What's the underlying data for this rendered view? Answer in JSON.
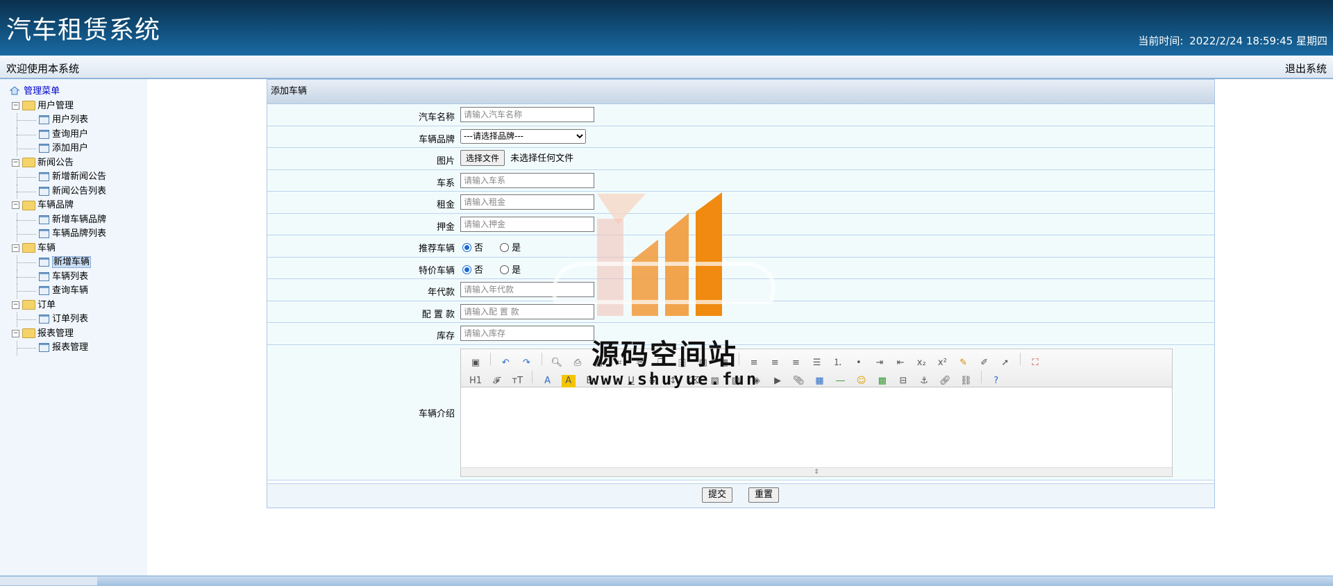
{
  "header": {
    "title": "汽车租赁系统",
    "clock_label": "当前时间:",
    "clock_value": "2022/2/24 18:59:45 星期四"
  },
  "welcome_bar": {
    "welcome": "欢迎使用本系统",
    "logout": "退出系统"
  },
  "sidebar": {
    "root": "管理菜单",
    "groups": [
      {
        "label": "用户管理",
        "items": [
          "用户列表",
          "查询用户",
          "添加用户"
        ]
      },
      {
        "label": "新闻公告",
        "items": [
          "新增新闻公告",
          "新闻公告列表"
        ]
      },
      {
        "label": "车辆品牌",
        "items": [
          "新增车辆品牌",
          "车辆品牌列表"
        ]
      },
      {
        "label": "车辆",
        "items": [
          "新增车辆",
          "车辆列表",
          "查询车辆"
        ]
      },
      {
        "label": "订单",
        "items": [
          "订单列表"
        ]
      },
      {
        "label": "报表管理",
        "items": [
          "报表管理"
        ]
      }
    ],
    "selected": "新增车辆"
  },
  "form": {
    "title": "添加车辆",
    "car_name": {
      "label": "汽车名称",
      "placeholder": "请输入汽车名称"
    },
    "brand": {
      "label": "车辆品牌",
      "selected": "---请选择品牌---"
    },
    "image": {
      "label": "图片",
      "button": "选择文件",
      "status": "未选择任何文件"
    },
    "series": {
      "label": "车系",
      "placeholder": "请输入车系"
    },
    "rent": {
      "label": "租金",
      "placeholder": "请输入租金"
    },
    "deposit": {
      "label": "押金",
      "placeholder": "请输入押金"
    },
    "recommended": {
      "label": "推荐车辆",
      "options": [
        "否",
        "是"
      ],
      "selected": "否"
    },
    "special": {
      "label": "特价车辆",
      "options": [
        "否",
        "是"
      ],
      "selected": "否"
    },
    "year": {
      "label": "年代款",
      "placeholder": "请输入年代款"
    },
    "config": {
      "label": "配 置 款",
      "placeholder": "请输入配 置 款"
    },
    "stock": {
      "label": "库存",
      "placeholder": "请输入库存"
    },
    "intro": {
      "label": "车辆介绍"
    },
    "submit": "提交",
    "reset": "重置"
  },
  "watermark": {
    "title": "源码空间站",
    "url": "www.shuyue.fun"
  }
}
